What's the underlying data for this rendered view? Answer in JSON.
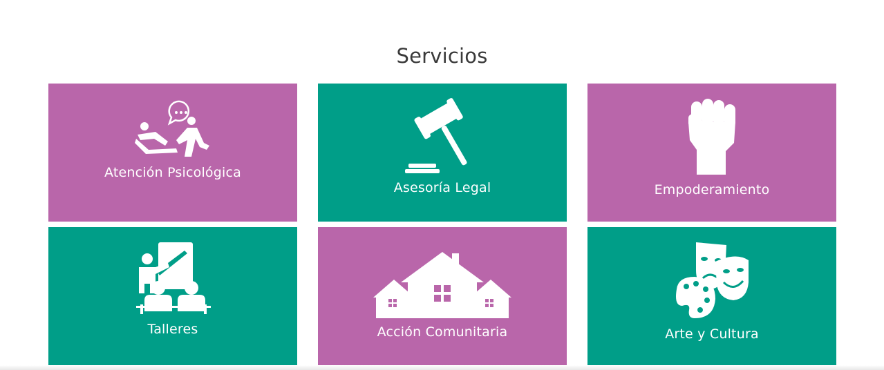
{
  "section": {
    "title": "Servicios"
  },
  "services": [
    {
      "label": "Atención Psicológica",
      "icon": "therapy-session-icon",
      "color": "#b966aa"
    },
    {
      "label": "Asesoría Legal",
      "icon": "gavel-icon",
      "color": "#009e88"
    },
    {
      "label": "Empoderamiento",
      "icon": "raised-fist-icon",
      "color": "#b966aa"
    },
    {
      "label": "Talleres",
      "icon": "workshop-teacher-icon",
      "color": "#009e88"
    },
    {
      "label": "Acción Comunitaria",
      "icon": "community-houses-icon",
      "color": "#b966aa"
    },
    {
      "label": "Arte y Cultura",
      "icon": "theater-masks-palette-icon",
      "color": "#009e88"
    }
  ]
}
